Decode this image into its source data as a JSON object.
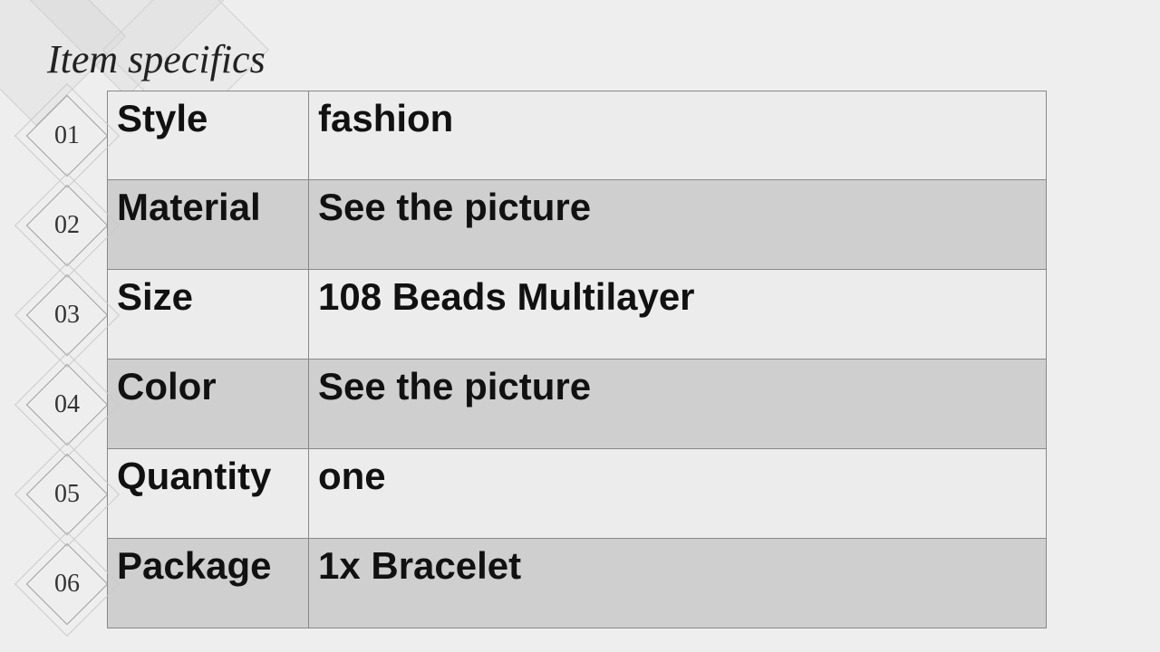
{
  "title": "Item specifics",
  "rows": [
    {
      "num": "01",
      "label": "Style",
      "value": "fashion"
    },
    {
      "num": "02",
      "label": "Material",
      "value": "See the picture"
    },
    {
      "num": "03",
      "label": "Size",
      "value": "108  Beads Multilayer"
    },
    {
      "num": "04",
      "label": "Color",
      "value": "See the picture"
    },
    {
      "num": "05",
      "label": "Quantity",
      "value": "one"
    },
    {
      "num": "06",
      "label": "Package",
      "value": "1x Bracelet"
    }
  ]
}
